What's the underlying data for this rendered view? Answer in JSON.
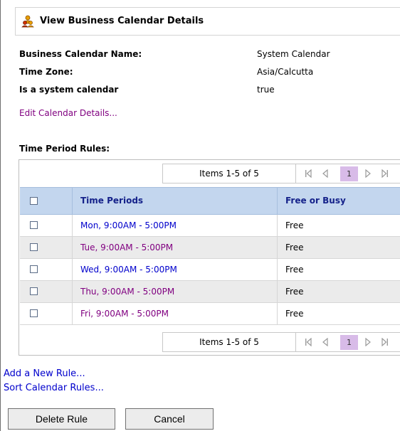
{
  "header": {
    "title": "View Business Calendar Details",
    "icon": "group-users-icon"
  },
  "details": [
    {
      "label": "Business Calendar Name:",
      "value": "System Calendar"
    },
    {
      "label": "Time Zone:",
      "value": "Asia/Calcutta"
    },
    {
      "label": "Is a system calendar",
      "value": "true"
    }
  ],
  "edit_link": "Edit Calendar Details...",
  "rules_section": {
    "title": "Time Period Rules:"
  },
  "pager": {
    "items_text": "Items 1-5 of 5",
    "current_page": "1"
  },
  "table": {
    "columns": [
      "Time Periods",
      "Free or Busy"
    ],
    "rows": [
      {
        "period": "Mon, 9:00AM - 5:00PM",
        "status": "Free"
      },
      {
        "period": "Tue, 9:00AM - 5:00PM",
        "status": "Free"
      },
      {
        "period": "Wed, 9:00AM - 5:00PM",
        "status": "Free"
      },
      {
        "period": "Thu, 9:00AM - 5:00PM",
        "status": "Free"
      },
      {
        "period": "Fri, 9:00AM - 5:00PM",
        "status": "Free"
      }
    ]
  },
  "links": {
    "add_rule": "Add a New Rule...",
    "sort_rules": "Sort Calendar Rules..."
  },
  "buttons": {
    "delete": "Delete Rule",
    "cancel": "Cancel"
  },
  "colors": {
    "header_bg": "#c3d6ee",
    "header_text": "#15228a",
    "page_highlight": "#d8bbe8",
    "row_alt": "#ebebeb"
  }
}
